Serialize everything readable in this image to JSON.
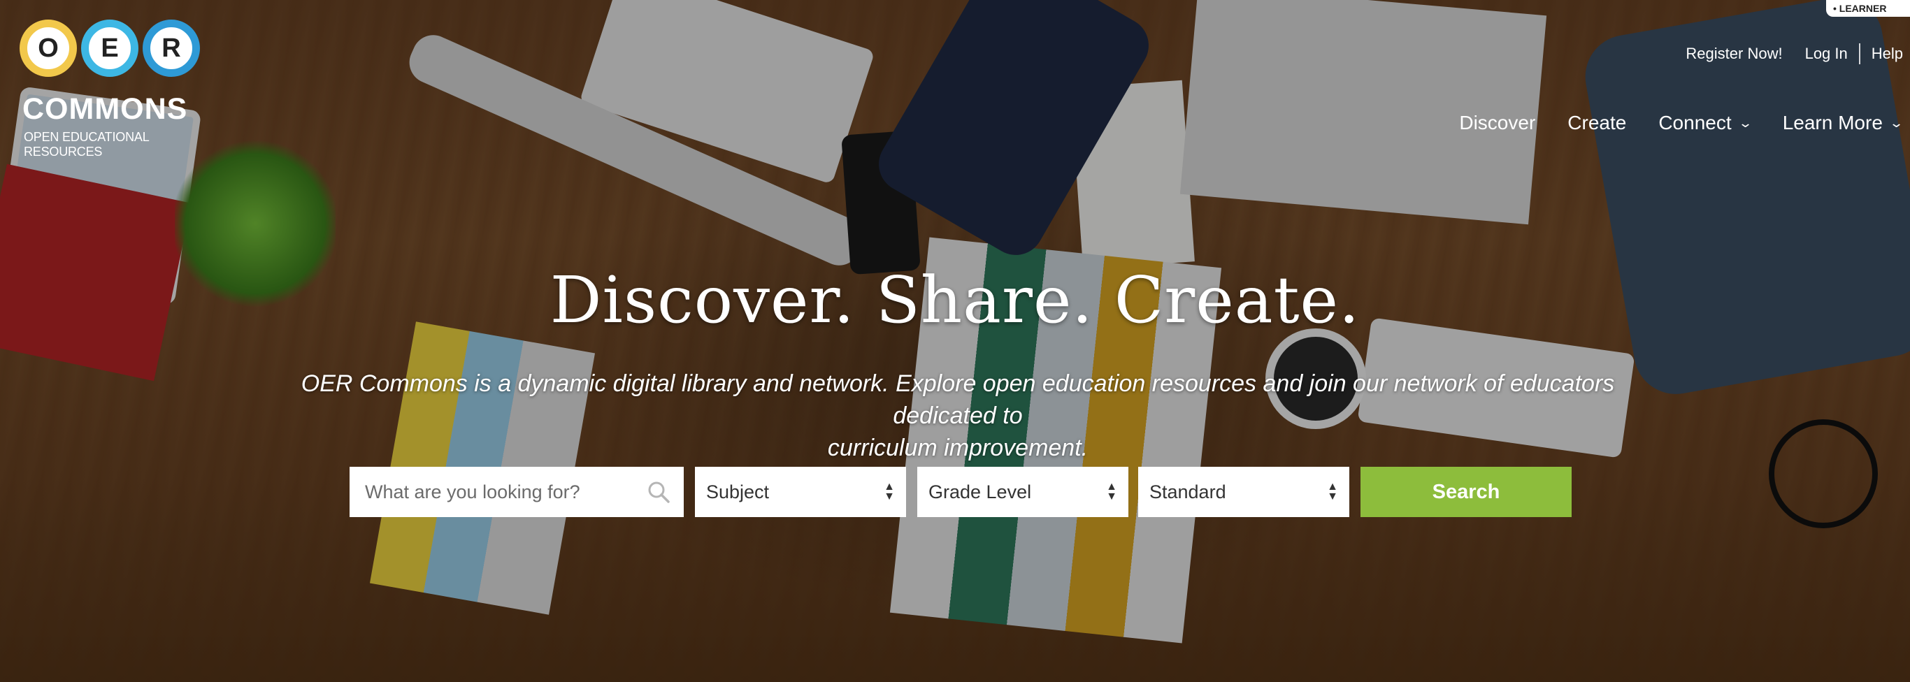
{
  "logo": {
    "letters": [
      "O",
      "E",
      "R"
    ],
    "name": "COMMONS",
    "tagline": "OPEN EDUCATIONAL RESOURCES",
    "ring_colors": [
      "#f2c84b",
      "#3db7e4",
      "#2e9ad6"
    ]
  },
  "corner_badge": "• LEARNER",
  "util_nav": {
    "register": "Register Now!",
    "login": "Log In",
    "help": "Help"
  },
  "main_nav": [
    {
      "label": "Discover",
      "dropdown": false
    },
    {
      "label": "Create",
      "dropdown": false
    },
    {
      "label": "Connect",
      "dropdown": true
    },
    {
      "label": "Learn More",
      "dropdown": true
    }
  ],
  "hero": {
    "headline": "Discover. Share. Create.",
    "tagline_line1": "OER Commons is a dynamic digital library and network. Explore open education resources and join our network of educators dedicated to",
    "tagline_line2": "curriculum improvement."
  },
  "search": {
    "placeholder": "What are you looking for?",
    "subject": "Subject",
    "grade": "Grade Level",
    "standard": "Standard",
    "button": "Search"
  },
  "colors": {
    "accent_green": "#8dbd3c"
  },
  "icons": {
    "search": "search-icon",
    "chevron": "chevron-down-icon",
    "select_arrows": "updown-arrows-icon"
  }
}
